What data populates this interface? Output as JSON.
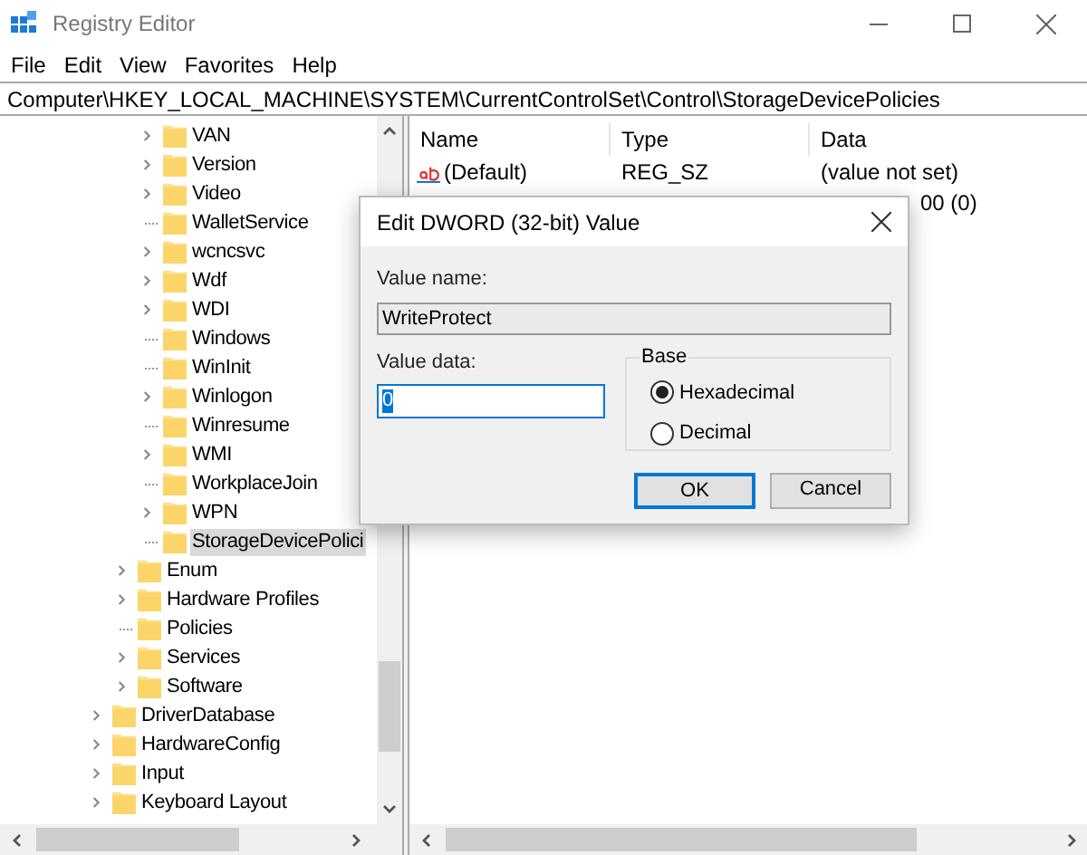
{
  "window": {
    "title": "Registry Editor"
  },
  "menu": [
    "File",
    "Edit",
    "View",
    "Favorites",
    "Help"
  ],
  "address": "Computer\\HKEY_LOCAL_MACHINE\\SYSTEM\\CurrentControlSet\\Control\\StorageDevicePolicies",
  "tree": {
    "control_subkeys": [
      {
        "label": "VAN",
        "expandable": true,
        "selected": false
      },
      {
        "label": "Version",
        "expandable": true,
        "selected": false
      },
      {
        "label": "Video",
        "expandable": true,
        "selected": false
      },
      {
        "label": "WalletService",
        "expandable": false,
        "selected": false
      },
      {
        "label": "wcncsvc",
        "expandable": true,
        "selected": false
      },
      {
        "label": "Wdf",
        "expandable": true,
        "selected": false
      },
      {
        "label": "WDI",
        "expandable": true,
        "selected": false
      },
      {
        "label": "Windows",
        "expandable": false,
        "selected": false
      },
      {
        "label": "WinInit",
        "expandable": false,
        "selected": false
      },
      {
        "label": "Winlogon",
        "expandable": true,
        "selected": false
      },
      {
        "label": "Winresume",
        "expandable": false,
        "selected": false
      },
      {
        "label": "WMI",
        "expandable": true,
        "selected": false
      },
      {
        "label": "WorkplaceJoin",
        "expandable": false,
        "selected": false
      },
      {
        "label": "WPN",
        "expandable": true,
        "selected": false
      },
      {
        "label": "StorageDevicePolici",
        "expandable": false,
        "selected": true
      }
    ],
    "current_control_set_subkeys": [
      {
        "label": "Enum",
        "expandable": true,
        "selected": false
      },
      {
        "label": "Hardware Profiles",
        "expandable": true,
        "selected": false
      },
      {
        "label": "Policies",
        "expandable": false,
        "selected": false
      },
      {
        "label": "Services",
        "expandable": true,
        "selected": false
      },
      {
        "label": "Software",
        "expandable": true,
        "selected": false
      }
    ],
    "system_subkeys": [
      {
        "label": "DriverDatabase",
        "expandable": true,
        "selected": false
      },
      {
        "label": "HardwareConfig",
        "expandable": true,
        "selected": false
      },
      {
        "label": "Input",
        "expandable": true,
        "selected": false
      },
      {
        "label": "Keyboard Layout",
        "expandable": true,
        "selected": false
      }
    ]
  },
  "values": {
    "columns": [
      "Name",
      "Type",
      "Data"
    ],
    "rows": [
      {
        "kind": "string",
        "name": "(Default)",
        "type": "REG_SZ",
        "data": "(value not set)"
      },
      {
        "kind": "covered",
        "data": "00 (0)"
      }
    ]
  },
  "dialog": {
    "title": "Edit DWORD (32-bit) Value",
    "value_name_label": "Value name:",
    "value_name": "WriteProtect",
    "value_data_label": "Value data:",
    "value_data": "0",
    "base_label": "Base",
    "bases": [
      {
        "label": "Hexadecimal",
        "selected": true
      },
      {
        "label": "Decimal",
        "selected": false
      }
    ],
    "buttons": [
      {
        "label": "OK",
        "default": true
      },
      {
        "label": "Cancel",
        "default": false
      }
    ]
  }
}
